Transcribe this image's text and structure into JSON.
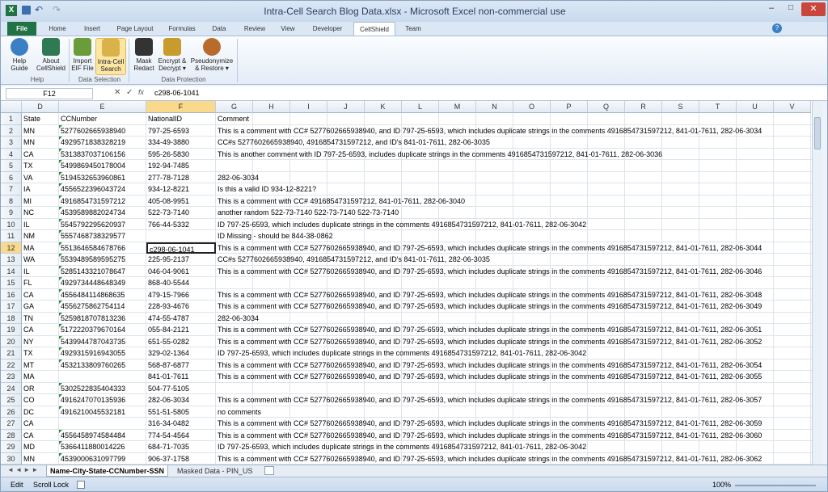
{
  "title": "Intra-Cell Search Blog Data.xlsx  -  Microsoft Excel non-commercial use",
  "tabs": [
    "File",
    "Home",
    "Insert",
    "Page Layout",
    "Formulas",
    "Data",
    "Review",
    "View",
    "Developer",
    "CellShield",
    "Team"
  ],
  "ribbon": {
    "buttons": [
      {
        "l1": "Help",
        "l2": "Guide",
        "color": "#3b7fc4"
      },
      {
        "l1": "About",
        "l2": "CellShield",
        "color": "#2f7a52"
      },
      {
        "l1": "Import",
        "l2": "EIF File",
        "color": "#6a9d3a"
      },
      {
        "l1": "Intra-Cell",
        "l2": "Search",
        "color": "#d9b34a"
      },
      {
        "l1": "Mask",
        "l2": "Redact",
        "color": "#333"
      },
      {
        "l1": "Encrypt &",
        "l2": "Decrypt ▾",
        "color": "#c89b2c"
      },
      {
        "l1": "Pseudonymize",
        "l2": "& Restore ▾",
        "color": "#b86b2a"
      }
    ],
    "groups": [
      "Help",
      "Data Selection",
      "Data Protection"
    ]
  },
  "formula": {
    "namebox": "F12",
    "fx": "fx",
    "value": "c298-06-1041"
  },
  "columns": [
    "D",
    "E",
    "F",
    "G",
    "H",
    "I",
    "J",
    "K",
    "L",
    "M",
    "N",
    "O",
    "P",
    "Q",
    "R",
    "S",
    "T",
    "U",
    "V"
  ],
  "rows": [
    [
      "1",
      "State",
      "CCNumber",
      "NationalID",
      "Comment"
    ],
    [
      "2",
      "MN",
      "5277602665938940",
      "797-25-6593",
      "This is a comment with CC# 5277602665938940, and ID 797-25-6593, which includes duplicate strings in the comments 4916854731597212, 841-01-7611, 282-06-3034"
    ],
    [
      "3",
      "MN",
      "4929571838328219",
      "334-49-3880",
      "CC#s 5277602665938940,  4916854731597212, and ID's 841-01-7611, 282-06-3035"
    ],
    [
      "4",
      "CA",
      "5313837037106156",
      "595-26-5830",
      "This is another  comment with ID 797-25-6593, includes duplicate strings in the comments 4916854731597212, 841-01-7611, 282-06-3036"
    ],
    [
      "5",
      "TX",
      "5499869450178004",
      "192-94-7485",
      ""
    ],
    [
      "6",
      "VA",
      "5194532653960861",
      "277-78-7128",
      "282-06-3034"
    ],
    [
      "7",
      "IA",
      "4556522396043724",
      "934-12-8221",
      "Is this a valid ID  934-12-8221?"
    ],
    [
      "8",
      "MI",
      "4916854731597212",
      "405-08-9951",
      "This is a comment with CC#  4916854731597212, 841-01-7611, 282-06-3040"
    ],
    [
      "9",
      "NC",
      "4539589882024734",
      "522-73-7140",
      "another random 522-73-7140 522-73-7140 522-73-7140"
    ],
    [
      "10",
      "IL",
      "5545792295620937",
      "766-44-5332",
      "ID 797-25-6593, which includes duplicate strings in the comments 4916854731597212, 841-01-7611, 282-06-3042"
    ],
    [
      "11",
      "NM",
      "5557468738329577",
      "",
      "ID Missing - should be 844-38-0862"
    ],
    [
      "12",
      "MA",
      "5513646584678766",
      "c298-06-1041",
      "This is a comment with CC# 5277602665938940, and ID 797-25-6593, which includes duplicate strings in the comments 4916854731597212, 841-01-7611, 282-06-3044"
    ],
    [
      "13",
      "WA",
      "5539489589595275",
      "225-95-2137",
      "CC#s 5277602665938940,  4916854731597212, and ID's 841-01-7611, 282-06-3035"
    ],
    [
      "14",
      "IL",
      "5285143321078647",
      "046-04-9061",
      "This is a comment with CC# 5277602665938940, and ID 797-25-6593, which includes duplicate strings in the comments 4916854731597212, 841-01-7611, 282-06-3046"
    ],
    [
      "15",
      "FL",
      "4929734448648349",
      "868-40-5544",
      ""
    ],
    [
      "16",
      "CA",
      "4556484114868635",
      "479-15-7966",
      "This is a comment with CC# 5277602665938940, and ID 797-25-6593, which includes duplicate strings in the comments 4916854731597212, 841-01-7611, 282-06-3048"
    ],
    [
      "17",
      "GA",
      "4556275862754114",
      "228-93-4676",
      "This is a comment with CC# 5277602665938940, and ID 797-25-6593, which includes duplicate strings in the comments 4916854731597212, 841-01-7611, 282-06-3049"
    ],
    [
      "18",
      "TN",
      "5259818707813236",
      "474-55-4787",
      "282-06-3034"
    ],
    [
      "19",
      "CA",
      "5172220379670164",
      "055-84-2121",
      "This is a comment with CC# 5277602665938940, and ID 797-25-6593, which includes duplicate strings in the comments 4916854731597212, 841-01-7611, 282-06-3051"
    ],
    [
      "20",
      "NY",
      "5439944787043735",
      "651-55-0282",
      "This is a comment with CC# 5277602665938940, and ID 797-25-6593, which includes duplicate strings in the comments 4916854731597212, 841-01-7611, 282-06-3052"
    ],
    [
      "21",
      "TX",
      "4929315916943055",
      "329-02-1364",
      "ID 797-25-6593, which includes duplicate strings in the comments 4916854731597212, 841-01-7611, 282-06-3042"
    ],
    [
      "22",
      "MT",
      "4532133809760265",
      "568-87-6877",
      "This is a comment with CC# 5277602665938940, and ID 797-25-6593, which includes duplicate strings in the comments 4916854731597212, 841-01-7611, 282-06-3054"
    ],
    [
      "23",
      "MA",
      "",
      "841-01-7611",
      "This is a comment with CC# 5277602665938940, and ID 797-25-6593, which includes duplicate strings in the comments 4916854731597212, 841-01-7611, 282-06-3055"
    ],
    [
      "24",
      "OR",
      "5302522835404333",
      "504-77-5105",
      ""
    ],
    [
      "25",
      "CO",
      "4916247070135936",
      "282-06-3034",
      "This is a comment with CC# 5277602665938940, and ID 797-25-6593, which includes duplicate strings in the comments 4916854731597212, 841-01-7611, 282-06-3057"
    ],
    [
      "26",
      "DC",
      "4916210045532181",
      "551-51-5805",
      "no comments"
    ],
    [
      "27",
      "CA",
      "",
      "316-34-0482",
      "This is a comment with CC# 5277602665938940, and ID 797-25-6593, which includes duplicate strings in the comments 4916854731597212, 841-01-7611, 282-06-3059"
    ],
    [
      "28",
      "CA",
      "4556458974584484",
      "774-54-4564",
      "This is a comment with CC# 5277602665938940, and ID 797-25-6593, which includes duplicate strings in the comments 4916854731597212, 841-01-7611, 282-06-3060"
    ],
    [
      "29",
      "MD",
      "5366411880014226",
      "684-71-7035",
      "ID 797-25-6593, which includes duplicate strings in the comments 4916854731597212, 841-01-7611, 282-06-3042"
    ],
    [
      "30",
      "MN",
      "4539000631097799",
      "906-37-1758",
      "This is a comment with CC# 5277602665938940, and ID 797-25-6593, which includes duplicate strings in the comments 4916854731597212, 841-01-7611, 282-06-3062"
    ]
  ],
  "sheets": [
    "Name-City-State-CCNumber-SSN",
    "Masked Data - PIN_US"
  ],
  "status": {
    "mode": "Edit",
    "scroll": "Scroll Lock",
    "zoom": "100%"
  },
  "accent": "#217346"
}
